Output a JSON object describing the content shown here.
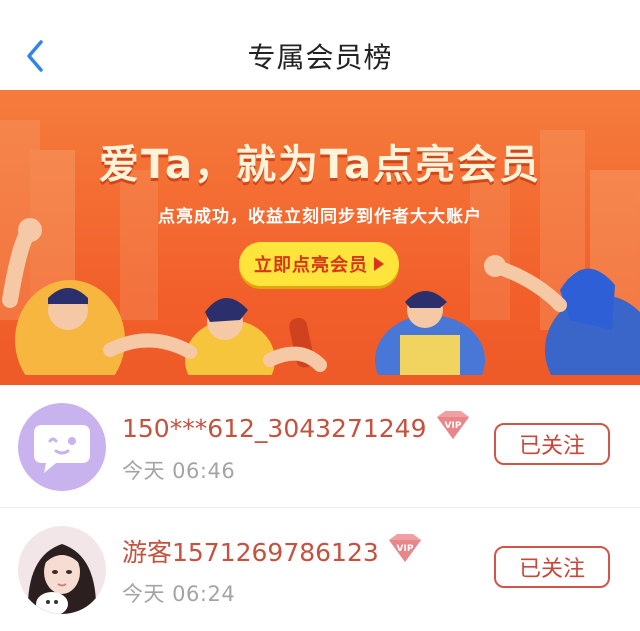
{
  "header": {
    "title": "专属会员榜",
    "back_icon": "chevron-left-icon"
  },
  "banner": {
    "headline": "爱Ta，就为Ta点亮会员",
    "subtitle": "点亮成功，收益立刻同步到作者大大账户",
    "cta_label": "立即点亮会员",
    "colors": {
      "background": "#f2652c",
      "cta": "#ffe43c",
      "cta_text": "#d8361a"
    }
  },
  "members": [
    {
      "name": "150***612_3043271249",
      "time": "今天 06:46",
      "follow_label": "已关注",
      "badge": "VIP",
      "avatar": "chat-bubble-avatar"
    },
    {
      "name": "游客1571269786123",
      "time": "今天 06:24",
      "follow_label": "已关注",
      "badge": "VIP",
      "avatar": "photo-avatar"
    }
  ],
  "colors": {
    "accent": "#c5513e",
    "vip": "#e8878a",
    "avatar_purple": "#c9b3ef"
  }
}
